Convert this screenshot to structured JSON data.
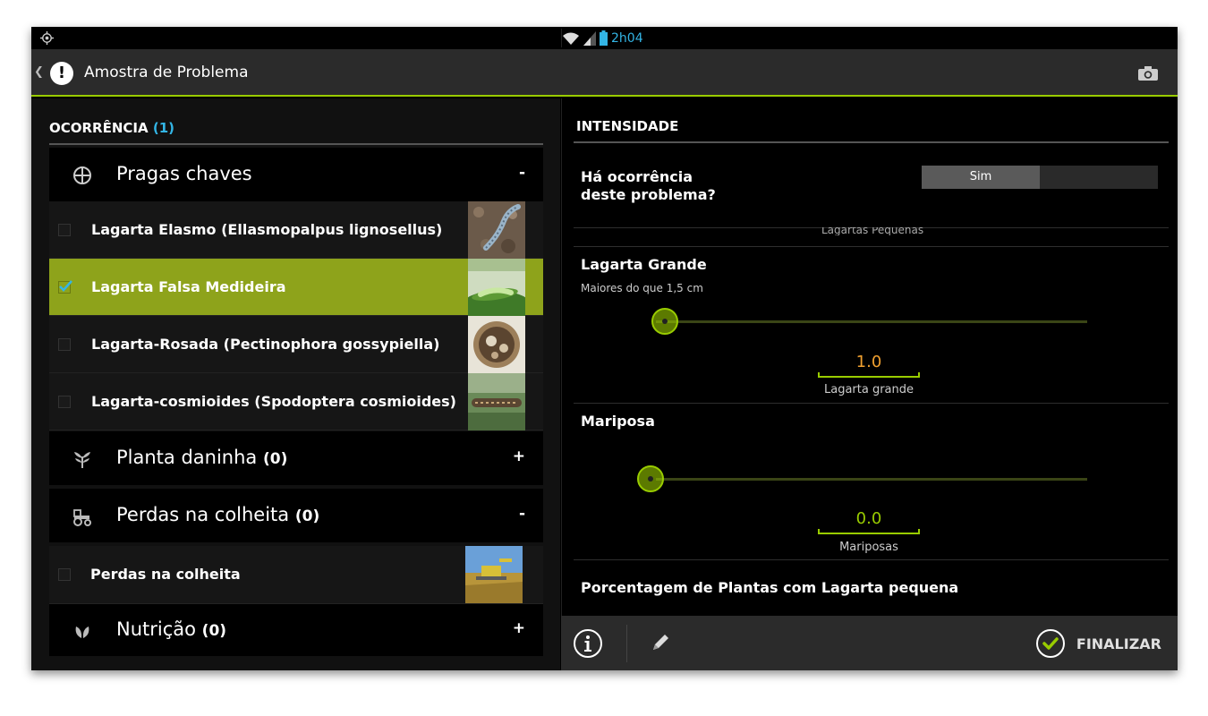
{
  "status_bar": {
    "time": "2h04"
  },
  "action_bar": {
    "title": "Amostra de Problema"
  },
  "left": {
    "header": {
      "label": "OCORRÊNCIA",
      "count": "(1)"
    },
    "categories": [
      {
        "label": "Pragas chaves",
        "count": "",
        "toggle": "-"
      },
      {
        "label": "Planta daninha",
        "count": "(0)",
        "toggle": "+"
      },
      {
        "label": "Perdas na colheita",
        "count": "(0)",
        "toggle": "-"
      },
      {
        "label": "Nutrição",
        "count": "(0)",
        "toggle": "+"
      }
    ],
    "items": [
      {
        "label": "Lagarta Elasmo (Ellasmopalpus lignosellus)",
        "checked": false
      },
      {
        "label": "Lagarta Falsa Medideira",
        "checked": true
      },
      {
        "label": "Lagarta-Rosada (Pectinophora gossypiella)",
        "checked": false
      },
      {
        "label": "Lagarta-cosmioides (Spodoptera cosmioides)",
        "checked": false
      },
      {
        "label": "Perdas na colheita",
        "checked": false
      }
    ]
  },
  "right": {
    "header": "INTENSIDADE",
    "question": {
      "line1": "Há ocorrência",
      "line2": "deste problema?",
      "toggle_on": "Sim"
    },
    "cut_label": "Lagartas Pequenas",
    "grande": {
      "title": "Lagarta Grande",
      "subtitle": "Maiores do que 1,5 cm",
      "value": "1.0",
      "unit": "Lagarta grande",
      "value_color": "#f0a030"
    },
    "mariposa": {
      "title": "Mariposa",
      "value": "0.0",
      "unit": "Mariposas",
      "value_color": "#99cc00"
    },
    "percent_title": "Porcentagem de Plantas com Lagarta pequena"
  },
  "bottom_bar": {
    "finish_label": "FINALIZAR"
  },
  "colors": {
    "accent": "#99cc00",
    "selected_row": "#8ea31b",
    "time": "#33b5e5"
  }
}
